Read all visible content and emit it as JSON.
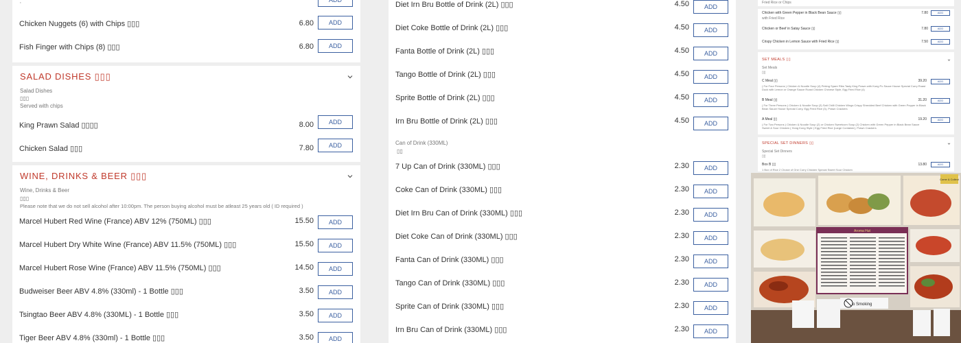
{
  "left": {
    "top_rows": [
      {
        "name": "Chicken Nuggets (6) with Chips ▯▯▯",
        "price": "6.80",
        "add": "ADD"
      },
      {
        "name": "Fish Finger with Chips (8) ▯▯▯",
        "price": "6.80",
        "add": "ADD"
      }
    ],
    "salad": {
      "title": "Salad Dishes ▯▯▯",
      "sub1": "Salad Dishes",
      "sub2": "▯▯▯",
      "sub3": "Served with chips",
      "rows": [
        {
          "name": "King Prawn Salad ▯▯▯▯",
          "price": "8.00",
          "add": "ADD"
        },
        {
          "name": "Chicken Salad ▯▯▯",
          "price": "7.80",
          "add": "ADD"
        }
      ]
    },
    "wine": {
      "title": "Wine, Drinks & Beer ▯▯▯",
      "sub1": "Wine, Drinks & Beer",
      "sub2": "▯▯▯",
      "sub3": "Please note that we do not sell alcohol after 10:00pm. The person buying alcohol must be atleast 25 years old ( ID required )",
      "rows": [
        {
          "name": "Marcel Hubert Red Wine (France) ABV 12% (750ML) ▯▯▯",
          "price": "15.50",
          "add": "ADD"
        },
        {
          "name": "Marcel Hubert Dry White Wine (France) ABV 11.5% (750ML) ▯▯▯",
          "price": "15.50",
          "add": "ADD"
        },
        {
          "name": "Marcel Hubert Rose Wine (France) ABV 11.5% (750ML) ▯▯▯",
          "price": "14.50",
          "add": "ADD"
        },
        {
          "name": "Budweiser Beer ABV 4.8% (330ml) - 1 Bottle ▯▯▯",
          "price": "3.50",
          "add": "ADD"
        },
        {
          "name": "Tsingtao Beer ABV 4.8% (330ML) - 1 Bottle ▯▯▯",
          "price": "3.50",
          "add": "ADD"
        },
        {
          "name": "Tiger Beer ABV 4.8% (330ml) - 1 Bottle ▯▯▯",
          "price": "3.50",
          "add": "ADD"
        }
      ]
    }
  },
  "middle": {
    "bottle_rows": [
      {
        "name": "Diet Irn Bru Bottle of Drink (2L) ▯▯▯",
        "price": "4.50",
        "add": "ADD"
      },
      {
        "name": "Diet Coke Bottle of Drink (2L) ▯▯▯",
        "price": "4.50",
        "add": "ADD"
      },
      {
        "name": "Fanta Bottle of Drink (2L) ▯▯▯",
        "price": "4.50",
        "add": "ADD"
      },
      {
        "name": "Tango Bottle of Drink (2L) ▯▯▯",
        "price": "4.50",
        "add": "ADD"
      },
      {
        "name": "Sprite Bottle of Drink (2L) ▯▯▯",
        "price": "4.50",
        "add": "ADD"
      },
      {
        "name": "Irn Bru Bottle of Drink (2L) ▯▯▯",
        "price": "4.50",
        "add": "ADD"
      }
    ],
    "can_sub1": "Can of Drink (330ML)",
    "can_sub2": "▯▯",
    "can_rows": [
      {
        "name": "7 Up Can of Drink (330ML) ▯▯▯",
        "price": "2.30",
        "add": "ADD"
      },
      {
        "name": "Coke Can of Drink (330ML) ▯▯▯",
        "price": "2.30",
        "add": "ADD"
      },
      {
        "name": "Diet Irn Bru Can of Drink (330ML) ▯▯▯",
        "price": "2.30",
        "add": "ADD"
      },
      {
        "name": "Diet Coke Can of Drink (330ML) ▯▯▯",
        "price": "2.30",
        "add": "ADD"
      },
      {
        "name": "Fanta Can of Drink (330ML) ▯▯▯",
        "price": "2.30",
        "add": "ADD"
      },
      {
        "name": "Tango Can of Drink (330ML) ▯▯▯",
        "price": "2.30",
        "add": "ADD"
      },
      {
        "name": "Sprite Can of Drink (330ML) ▯▯▯",
        "price": "2.30",
        "add": "ADD"
      },
      {
        "name": "Irn Bru Can of Drink (330ML) ▯▯▯",
        "price": "2.30",
        "add": "ADD"
      }
    ]
  },
  "right": {
    "top_line": "Fried Rice or Chips",
    "top_rows": [
      {
        "name": "Chicken with Green Pepper in Black Bean Sauce ▯▯",
        "note": "with Fried Rice",
        "price": "7.80",
        "add": "ADD"
      },
      {
        "name": "Chicken or Beef in Satay Sauce ▯▯",
        "note": "",
        "price": "7.80",
        "add": "ADD"
      },
      {
        "name": "Crispy Chicken in Lemon Sauce with Fried Rice ▯▯",
        "note": "",
        "price": "7.50",
        "add": "ADD"
      }
    ],
    "set_meals": {
      "title": "Set Meals ▯▯",
      "sub1": "Set Meals",
      "sub2": "▯▯",
      "rows": [
        {
          "name": "C Meal ▯▯",
          "note": "( For Four Persons ) Chicken & Noodle Soup (4) Peking Spare Ribs Tasty King Prawn with Kung Po Sauce House Special Curry Roast Duck with Lemon or Orange Sauce Roast Chicken Chinese Style, Egg Fried Rice (4)",
          "price": "39.20",
          "add": "ADD"
        },
        {
          "name": "B Meal ▯▯",
          "note": "( For Three Persons ) Chicken & Noodle Soup (3) Salt Chilli Chicken Wings Crispy Shredded Beef Chicken with Green Pepper in Black Bean Sauce House Special Curry, Egg Fried Rice (3), Prawn Crackers",
          "price": "31.20",
          "add": "ADD"
        },
        {
          "name": "A Meal ▯▯",
          "note": "( For Two Persons ) Chicken & Noodle Soup (2) or Chicken Sweetcorn Soup (2) Chicken with Green Pepper in Black Bean Sauce Sweet & Sour Chicken ( Hong Kong Style ) Egg Fried Rice (Large Container), Prawn Crackers",
          "price": "19.20",
          "add": "ADD"
        }
      ]
    },
    "special": {
      "title": "Special Set Dinners ▯▯",
      "sub1": "Special Set Dinners",
      "sub2": "▯▯",
      "rows": [
        {
          "name": "Box B ▯▯",
          "note": "1 Box of Rice 2 Choice of One Curry Chicken Special Sweet Sour Chicken",
          "price": "13.80",
          "add": "ADD"
        }
      ]
    },
    "photo": {
      "no_smoking": "No Smoking",
      "shop_sign": "Aroma Hut",
      "sticker": "Come & Collect"
    }
  },
  "colors": {
    "accent": "#c0392b",
    "button": "#3a5fa0",
    "background": "#eeeeee"
  }
}
